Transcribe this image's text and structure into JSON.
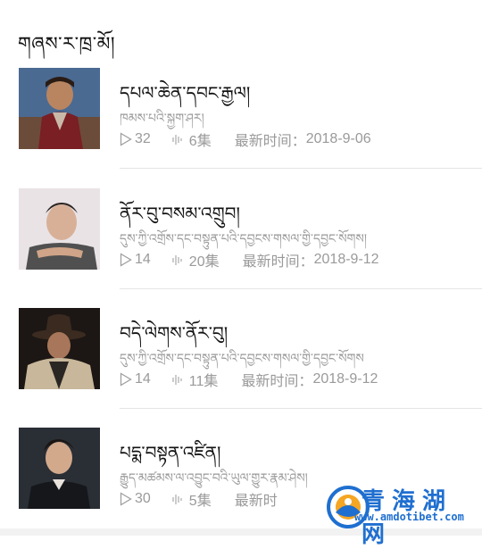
{
  "section": {
    "title": "གཞས་ར་ཁྲ་མོ།"
  },
  "albums": [
    {
      "title": "དཔལ་ཆེན་དབང་རྒྱལ།",
      "subtitle": "ཁམས་པའི་སྐྱག་ཤར།",
      "plays": "32",
      "episodes": "6集",
      "updated_label": "最新时间：",
      "updated": "2018-9-06"
    },
    {
      "title": "ནོར་བུ་བསམ་འགྲུབ།",
      "subtitle": "དུས་ཀྱི་འགྲོས་དང་བསྟུན་པའི་དབྱངས་གསལ་གྱི་དབྱང་སོགས།",
      "plays": "14",
      "episodes": "20集",
      "updated_label": "最新时间：",
      "updated": "2018-9-12"
    },
    {
      "title": "བདེ་ལེགས་ནོར་བུ།",
      "subtitle": "དུས་ཀྱི་འགྲོས་དང་བསྟུན་པའི་དབྱངས་གསལ་གྱི་དབྱང་སོགས",
      "plays": "14",
      "episodes": "11集",
      "updated_label": "最新时间：",
      "updated": "2018-9-12"
    },
    {
      "title": "པདྨ་བསྟན་འཛིན།",
      "subtitle": "རྒྱུད་མཚམས་ལ་འབྱུང་བའི་ཡུལ་གྱུར་རྣམ་ཤེས།",
      "plays": "30",
      "episodes": "5集",
      "updated_label": "最新时",
      "updated": ""
    }
  ],
  "watermark": {
    "name": "青海湖网",
    "url": "www.amdotibet.com"
  },
  "colors": {
    "text": "#111111",
    "muted": "#9a9a9a",
    "divider": "#e5e5e5",
    "watermark": "#1f6fd0"
  },
  "icons": {
    "plays": "play-icon",
    "episodes": "episodes-icon"
  }
}
